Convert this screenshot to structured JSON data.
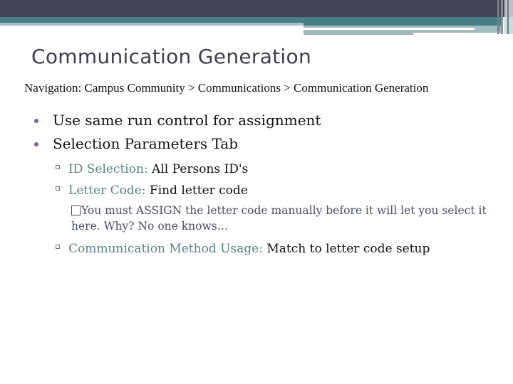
{
  "slide": {
    "title": "Communication Generation",
    "navigation": "Navigation: Campus Community > Communications > Communication Generation",
    "bullets": [
      {
        "text": "Use same run control for assignment"
      },
      {
        "text": "Selection Parameters Tab",
        "sub": [
          {
            "label": "ID Selection:",
            "value": " All Persons ID's"
          },
          {
            "label": "Letter Code:",
            "value": " Find letter code",
            "note": "You must ASSIGN the letter code manually before it will let you select it here. Why? No one knows…"
          },
          {
            "label": "Communication Method Usage:",
            "value": " Match to letter code setup"
          }
        ]
      }
    ]
  },
  "theme": {
    "header_dark": "#414355",
    "header_teal": "#467f84",
    "accent_label": "#5a8286",
    "bullet_dot": "#8a5a9b",
    "note_text": "#4c4e66"
  },
  "icons": {
    "level1_bullet": "dot-bullet-icon",
    "level2_bullet": "square-bullet-icon",
    "level3_bullet": "missing-glyph-box-icon"
  }
}
